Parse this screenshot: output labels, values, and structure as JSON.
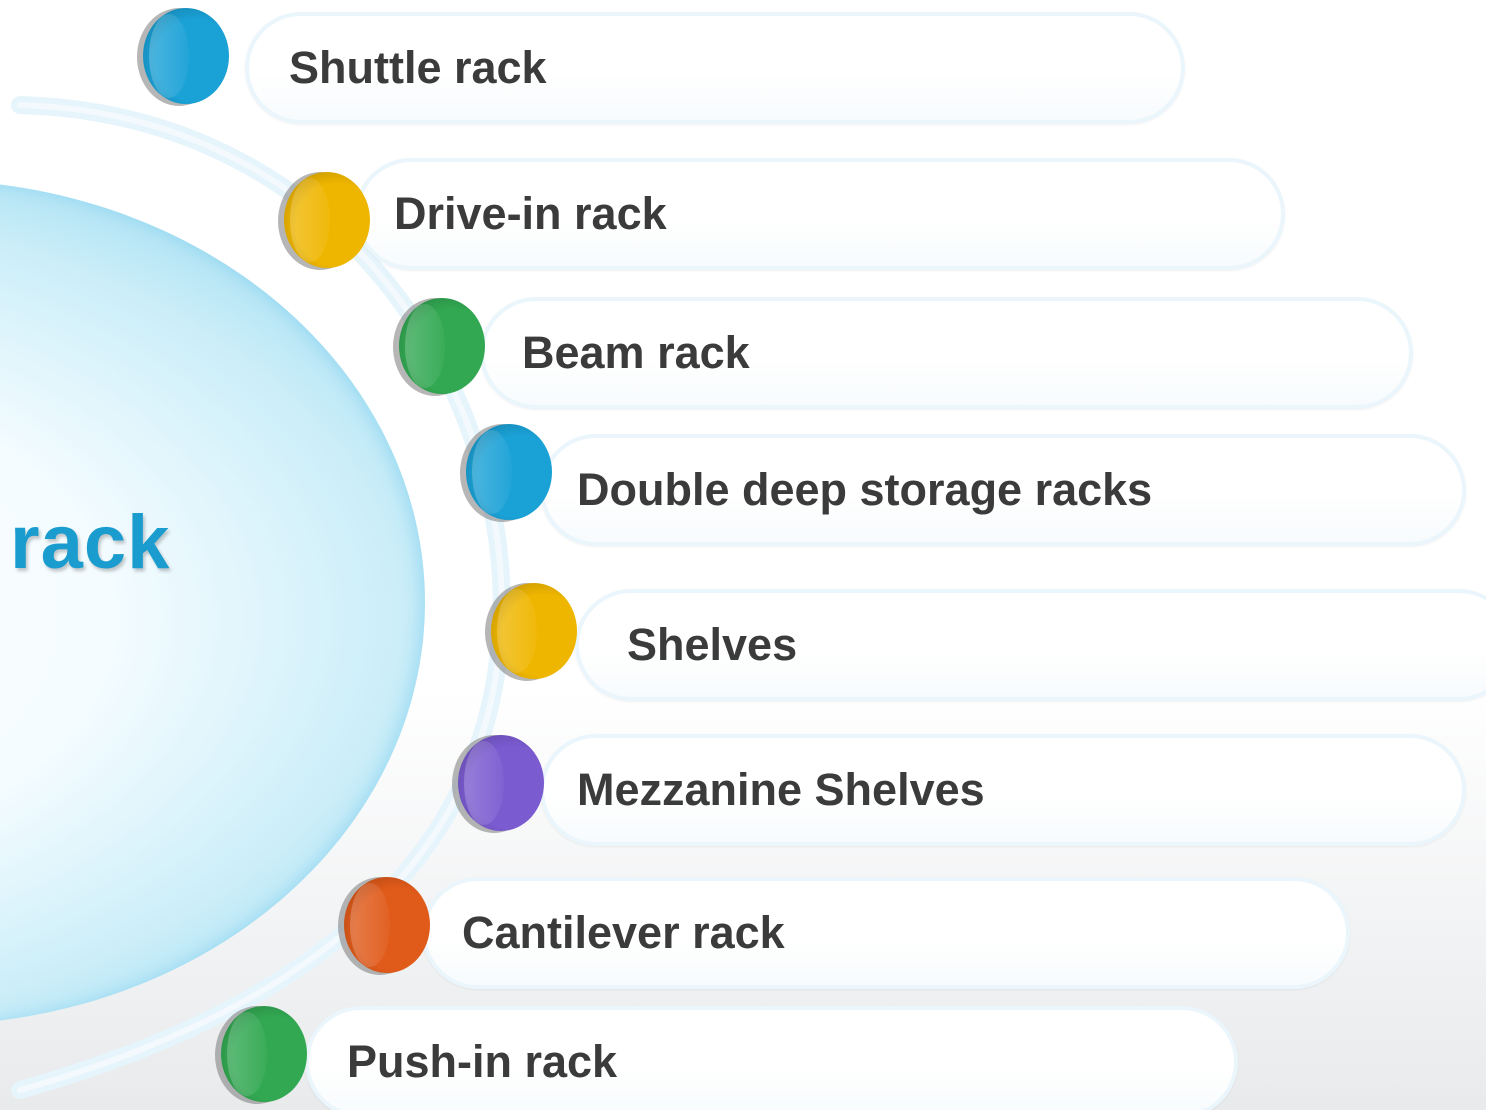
{
  "center": {
    "title": "rack"
  },
  "colors": {
    "blue": "#1aa1d6",
    "gold": "#efb600",
    "green": "#32a852",
    "purple": "#7b5bd0",
    "orange": "#e05a1a",
    "center_text": "#1a9ccf",
    "label_text": "#3b3b3b"
  },
  "items": [
    {
      "label": "Shuttle rack",
      "color": "blue"
    },
    {
      "label": "Drive-in rack",
      "color": "gold"
    },
    {
      "label": "Beam rack",
      "color": "green"
    },
    {
      "label": "Double deep storage racks",
      "color": "blue"
    },
    {
      "label": "Shelves",
      "color": "gold"
    },
    {
      "label": "Mezzanine Shelves",
      "color": "purple"
    },
    {
      "label": "Cantilever rack",
      "color": "orange"
    },
    {
      "label": "Push-in rack",
      "color": "green"
    }
  ]
}
